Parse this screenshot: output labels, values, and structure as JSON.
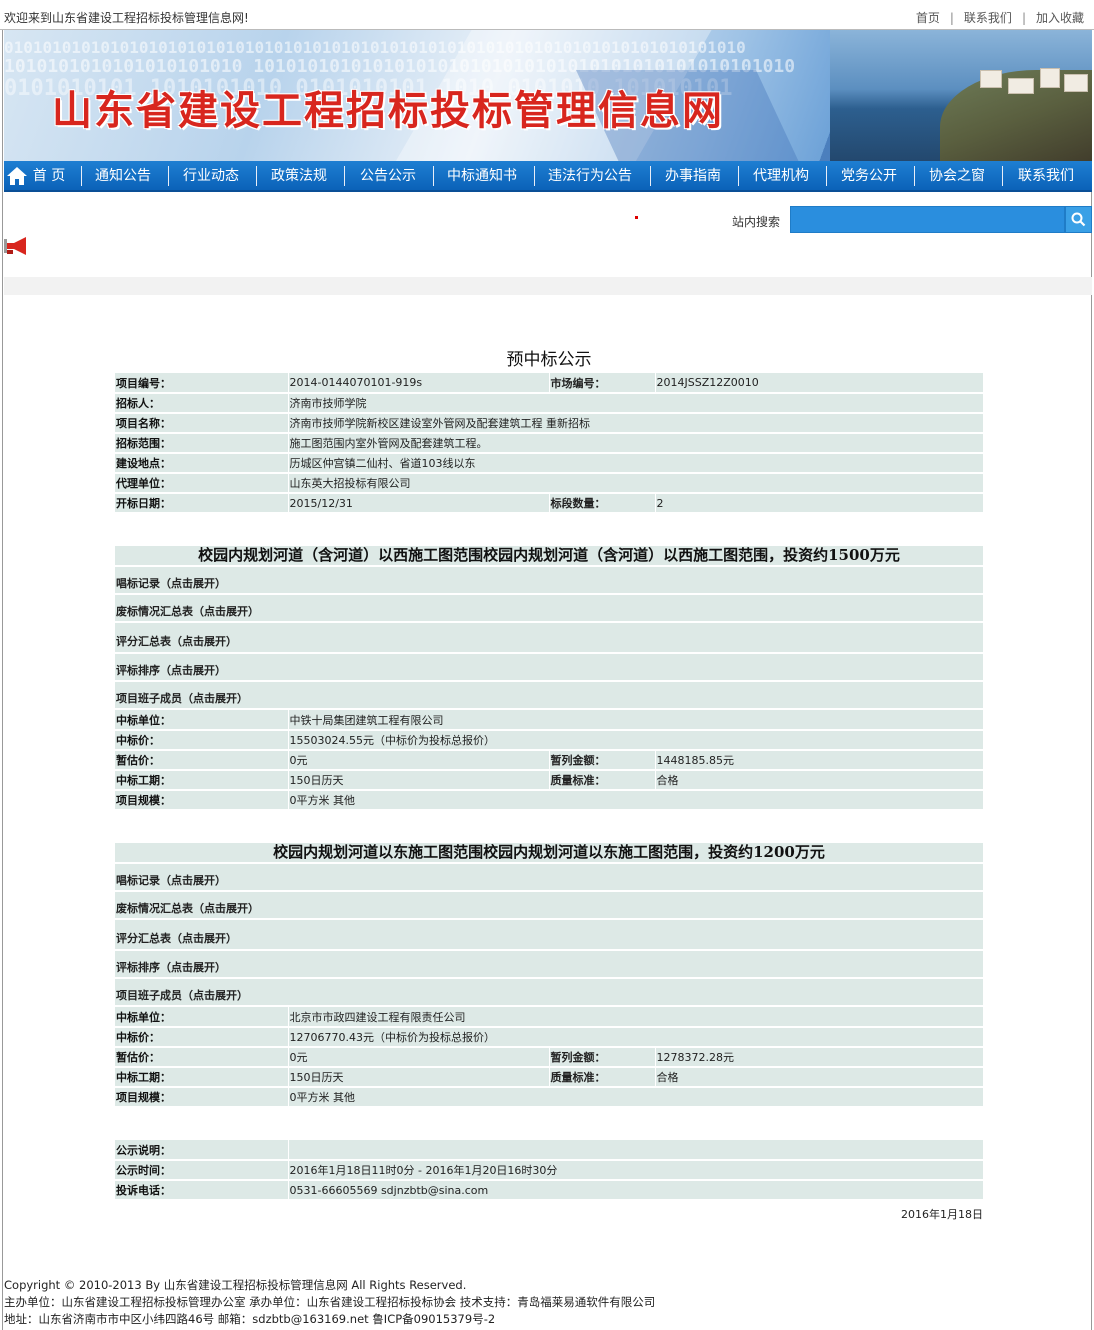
{
  "topbar": {
    "welcome": "欢迎来到山东省建设工程招标投标管理信息网!",
    "links": [
      "首页",
      "联系我们",
      "加入收藏"
    ]
  },
  "banner": {
    "title": "山东省建设工程招标投标管理信息网"
  },
  "nav": {
    "items": [
      "首 页",
      "通知公告",
      "行业动态",
      "政策法规",
      "公告公示",
      "中标通知书",
      "违法行为公告",
      "办事指南",
      "代理机构",
      "党务公开",
      "协会之窗",
      "联系我们"
    ]
  },
  "search": {
    "label": "站内搜索",
    "value": ""
  },
  "page": {
    "title": "预中标公示",
    "header_rows": [
      {
        "label": "项目编号：",
        "value": "2014-0144070101-919s",
        "label2": "市场编号：",
        "value2": "2014JSSZ12Z0010"
      },
      {
        "label": "招标人：",
        "value": "济南市技师学院"
      },
      {
        "label": "项目名称：",
        "value": "济南市技师学院新校区建设室外管网及配套建筑工程 重新招标"
      },
      {
        "label": "招标范围：",
        "value": "施工图范围内室外管网及配套建筑工程。"
      },
      {
        "label": "建设地点：",
        "value": "历城区仲宫镇二仙村、省道103线以东"
      },
      {
        "label": "代理单位：",
        "value": "山东英大招投标有限公司"
      },
      {
        "label": "开标日期：",
        "value": "2015/12/31",
        "label2": "标段数量：",
        "value2": "2"
      }
    ],
    "sections": [
      {
        "title": "校园内规划河道（含河道）以西施工图范围校园内规划河道（含河道）以西施工图范围，投资约1500万元",
        "expanders": [
          "唱标记录（点击展开）",
          "废标情况汇总表（点击展开）",
          "评分汇总表（点击展开）",
          "评标排序（点击展开）",
          "项目班子成员（点击展开）"
        ],
        "winner": {
          "label": "中标单位：",
          "value": "中铁十局集团建筑工程有限公司"
        },
        "price": {
          "label": "中标价：",
          "value": "15503024.55元（中标价为投标总报价）"
        },
        "est": {
          "label": "暂估价：",
          "value": "0元",
          "label2": "暂列金额：",
          "value2": "1448185.85元"
        },
        "period": {
          "label": "中标工期：",
          "value": "150日历天",
          "label2": "质量标准：",
          "value2": "合格"
        },
        "scale": {
          "label": "项目规模：",
          "value": "0平方米 其他"
        }
      },
      {
        "title": "校园内规划河道以东施工图范围校园内规划河道以东施工图范围，投资约1200万元",
        "expanders": [
          "唱标记录（点击展开）",
          "废标情况汇总表（点击展开）",
          "评分汇总表（点击展开）",
          "评标排序（点击展开）",
          "项目班子成员（点击展开）"
        ],
        "winner": {
          "label": "中标单位：",
          "value": "北京市市政四建设工程有限责任公司"
        },
        "price": {
          "label": "中标价：",
          "value": "12706770.43元（中标价为投标总报价）"
        },
        "est": {
          "label": "暂估价：",
          "value": "0元",
          "label2": "暂列金额：",
          "value2": "1278372.28元"
        },
        "period": {
          "label": "中标工期：",
          "value": "150日历天",
          "label2": "质量标准：",
          "value2": "合格"
        },
        "scale": {
          "label": "项目规模：",
          "value": "0平方米 其他"
        }
      }
    ],
    "notice": [
      {
        "label": "公示说明：",
        "value": ""
      },
      {
        "label": "公示时间：",
        "value": "2016年1月18日11时0分 - 2016年1月20日16时30分"
      },
      {
        "label": "投诉电话：",
        "value": "0531-66605569 sdjnzbtb@sina.com"
      }
    ],
    "date": "2016年1月18日"
  },
  "footer": {
    "line1": "Copyright © 2010-2013 By 山东省建设工程招标投标管理信息网  All Rights Reserved.",
    "line2": "主办单位：山东省建设工程招标投标管理办公室  承办单位：山东省建设工程招标投标协会  技术支持：青岛福莱易通软件有限公司",
    "line3": "地址：山东省济南市市中区小纬四路46号    邮箱：sdzbtb@163169.net    鲁ICP备09015379号-2"
  }
}
